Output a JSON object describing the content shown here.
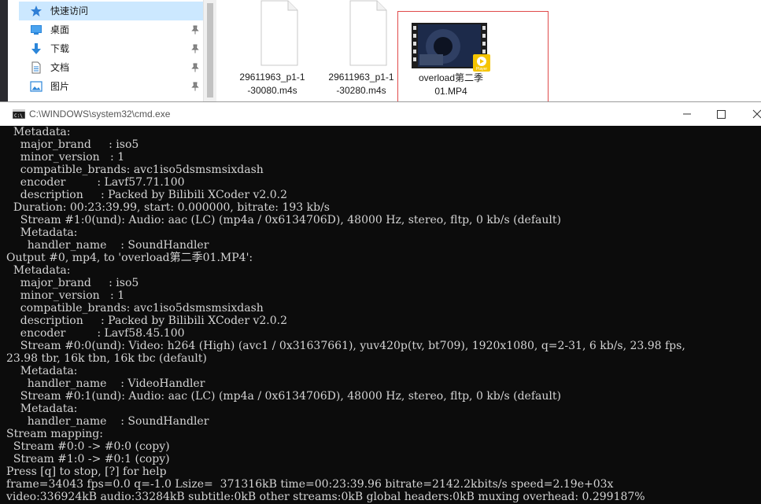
{
  "explorer": {
    "nav": [
      {
        "label": "快速访问",
        "icon": "star-icon",
        "selected": true
      },
      {
        "label": "桌面",
        "icon": "desktop-icon"
      },
      {
        "label": "下载",
        "icon": "download-icon"
      },
      {
        "label": "文档",
        "icon": "document-icon"
      },
      {
        "label": "图片",
        "icon": "pictures-icon"
      }
    ],
    "files": [
      {
        "name_line1": "29611963_p1-1",
        "name_line2": "-30080.m4s",
        "type": "generic-file-icon"
      },
      {
        "name_line1": "29611963_p1-1",
        "name_line2": "-30280.m4s",
        "type": "generic-file-icon"
      },
      {
        "name_line1": "overload第二季",
        "name_line2": "01.MP4",
        "type": "video-file-icon",
        "badge": "Player",
        "selected": true
      }
    ]
  },
  "cmd": {
    "title": "C:\\WINDOWS\\system32\\cmd.exe",
    "lines": [
      "  Metadata:",
      "    major_brand     : iso5",
      "    minor_version   : 1",
      "    compatible_brands: avc1iso5dsmsmsixdash",
      "    encoder         : Lavf57.71.100",
      "    description     : Packed by Bilibili XCoder v2.0.2",
      "  Duration: 00:23:39.99, start: 0.000000, bitrate: 193 kb/s",
      "    Stream #1:0(und): Audio: aac (LC) (mp4a / 0x6134706D), 48000 Hz, stereo, fltp, 0 kb/s (default)",
      "    Metadata:",
      "      handler_name    : SoundHandler",
      "Output #0, mp4, to 'overload第二季01.MP4':",
      "  Metadata:",
      "    major_brand     : iso5",
      "    minor_version   : 1",
      "    compatible_brands: avc1iso5dsmsmsixdash",
      "    description     : Packed by Bilibili XCoder v2.0.2",
      "    encoder         : Lavf58.45.100",
      "    Stream #0:0(und): Video: h264 (High) (avc1 / 0x31637661), yuv420p(tv, bt709), 1920x1080, q=2-31, 6 kb/s, 23.98 fps,",
      "23.98 tbr, 16k tbn, 16k tbc (default)",
      "    Metadata:",
      "      handler_name    : VideoHandler",
      "    Stream #0:1(und): Audio: aac (LC) (mp4a / 0x6134706D), 48000 Hz, stereo, fltp, 0 kb/s (default)",
      "    Metadata:",
      "      handler_name    : SoundHandler",
      "Stream mapping:",
      "  Stream #0:0 -> #0:0 (copy)",
      "  Stream #1:0 -> #0:1 (copy)",
      "Press [q] to stop, [?] for help",
      "frame=34043 fps=0.0 q=-1.0 Lsize=  371316kB time=00:23:39.96 bitrate=2142.2kbits/s speed=2.19e+03x",
      "video:336924kB audio:33284kB subtitle:0kB other streams:0kB global headers:0kB muxing overhead: 0.299187%"
    ]
  }
}
